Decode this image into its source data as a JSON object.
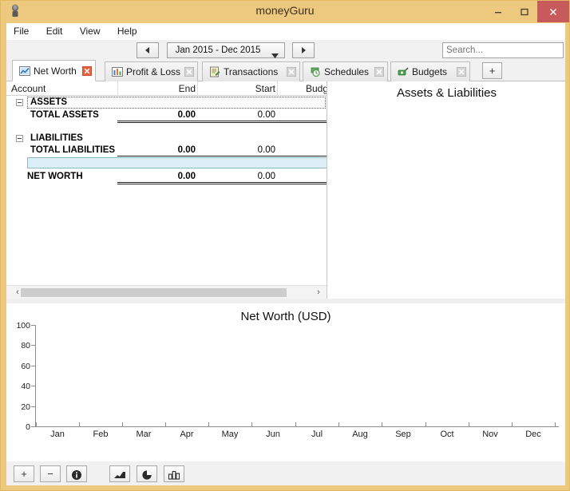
{
  "window": {
    "title": "moneyGuru",
    "app_icon": "moneyguru-app-icon",
    "minimize_label": "Minimize",
    "maximize_label": "Maximize",
    "close_label": "Close",
    "close_color": "#c75b5b",
    "frame_color": "#edc87f"
  },
  "menubar": {
    "items": [
      {
        "label": "File"
      },
      {
        "label": "Edit"
      },
      {
        "label": "View"
      },
      {
        "label": "Help"
      }
    ]
  },
  "toolbar": {
    "prev_icon": "left-triangle-icon",
    "next_icon": "right-triangle-icon",
    "date_range": "Jan 2015 - Dec 2015",
    "date_range_caret": "chevron-down-icon",
    "search_placeholder": "Search...",
    "search_value": ""
  },
  "tabs": {
    "items": [
      {
        "label": "Net Worth",
        "icon": "net-worth-icon",
        "active": true,
        "close_icon": "close-icon-red"
      },
      {
        "label": "Profit & Loss",
        "icon": "profit-loss-icon",
        "active": false,
        "close_icon": "close-icon"
      },
      {
        "label": "Transactions",
        "icon": "transactions-icon",
        "active": false,
        "close_icon": "close-icon"
      },
      {
        "label": "Schedules",
        "icon": "schedules-icon",
        "active": false,
        "close_icon": "close-icon"
      },
      {
        "label": "Budgets",
        "icon": "budgets-icon",
        "active": false,
        "close_icon": "close-icon"
      }
    ],
    "add_label": "+"
  },
  "table": {
    "columns": [
      "Account",
      "End",
      "Start",
      "Budget"
    ],
    "rows": [
      {
        "type": "group",
        "account": "ASSETS",
        "end": "",
        "start": "",
        "expander": true,
        "focused": true
      },
      {
        "type": "total",
        "account": "TOTAL ASSETS",
        "end": "0.00",
        "start": "0.00",
        "expander": false,
        "focused": false
      },
      {
        "type": "spacer",
        "account": "",
        "end": "",
        "start": "",
        "expander": false,
        "focused": false
      },
      {
        "type": "group",
        "account": "LIABILITIES",
        "end": "",
        "start": "",
        "expander": true,
        "focused": false
      },
      {
        "type": "total",
        "account": "TOTAL LIABILITIES",
        "end": "0.00",
        "start": "0.00",
        "expander": false,
        "focused": false
      },
      {
        "type": "selected",
        "account": "",
        "end": "",
        "start": "",
        "expander": false,
        "focused": false
      },
      {
        "type": "total",
        "account": "NET WORTH",
        "end": "0.00",
        "start": "0.00",
        "expander": false,
        "focused": false
      }
    ],
    "scroll_left_icon": "scroll-left-arrow",
    "scroll_right_icon": "scroll-right-arrow"
  },
  "pie_panel": {
    "title": "Assets & Liabilities"
  },
  "chart_data": {
    "type": "line",
    "title": "Net Worth (USD)",
    "xlabel": "",
    "ylabel": "",
    "categories": [
      "Jan",
      "Feb",
      "Mar",
      "Apr",
      "May",
      "Jun",
      "Jul",
      "Aug",
      "Sep",
      "Oct",
      "Nov",
      "Dec"
    ],
    "yticks": [
      0,
      20,
      40,
      60,
      80,
      100
    ],
    "ylim": [
      0,
      100
    ],
    "grid": false,
    "legend": null,
    "series": [
      {
        "name": "Net Worth",
        "values": [
          0,
          0,
          0,
          0,
          0,
          0,
          0,
          0,
          0,
          0,
          0,
          0
        ]
      }
    ]
  },
  "bottombar": {
    "buttons": [
      {
        "name": "add-account-button",
        "label": "+",
        "icon": "plus-icon"
      },
      {
        "name": "remove-account-button",
        "label": "−",
        "icon": "minus-icon"
      },
      {
        "name": "account-info-button",
        "label": "",
        "icon": "info-icon"
      },
      {
        "name": "area-graph-button",
        "label": "",
        "icon": "area-chart-icon"
      },
      {
        "name": "pie-chart-button",
        "label": "",
        "icon": "pie-chart-icon"
      },
      {
        "name": "columns-button",
        "label": "",
        "icon": "bar-columns-icon"
      }
    ]
  }
}
